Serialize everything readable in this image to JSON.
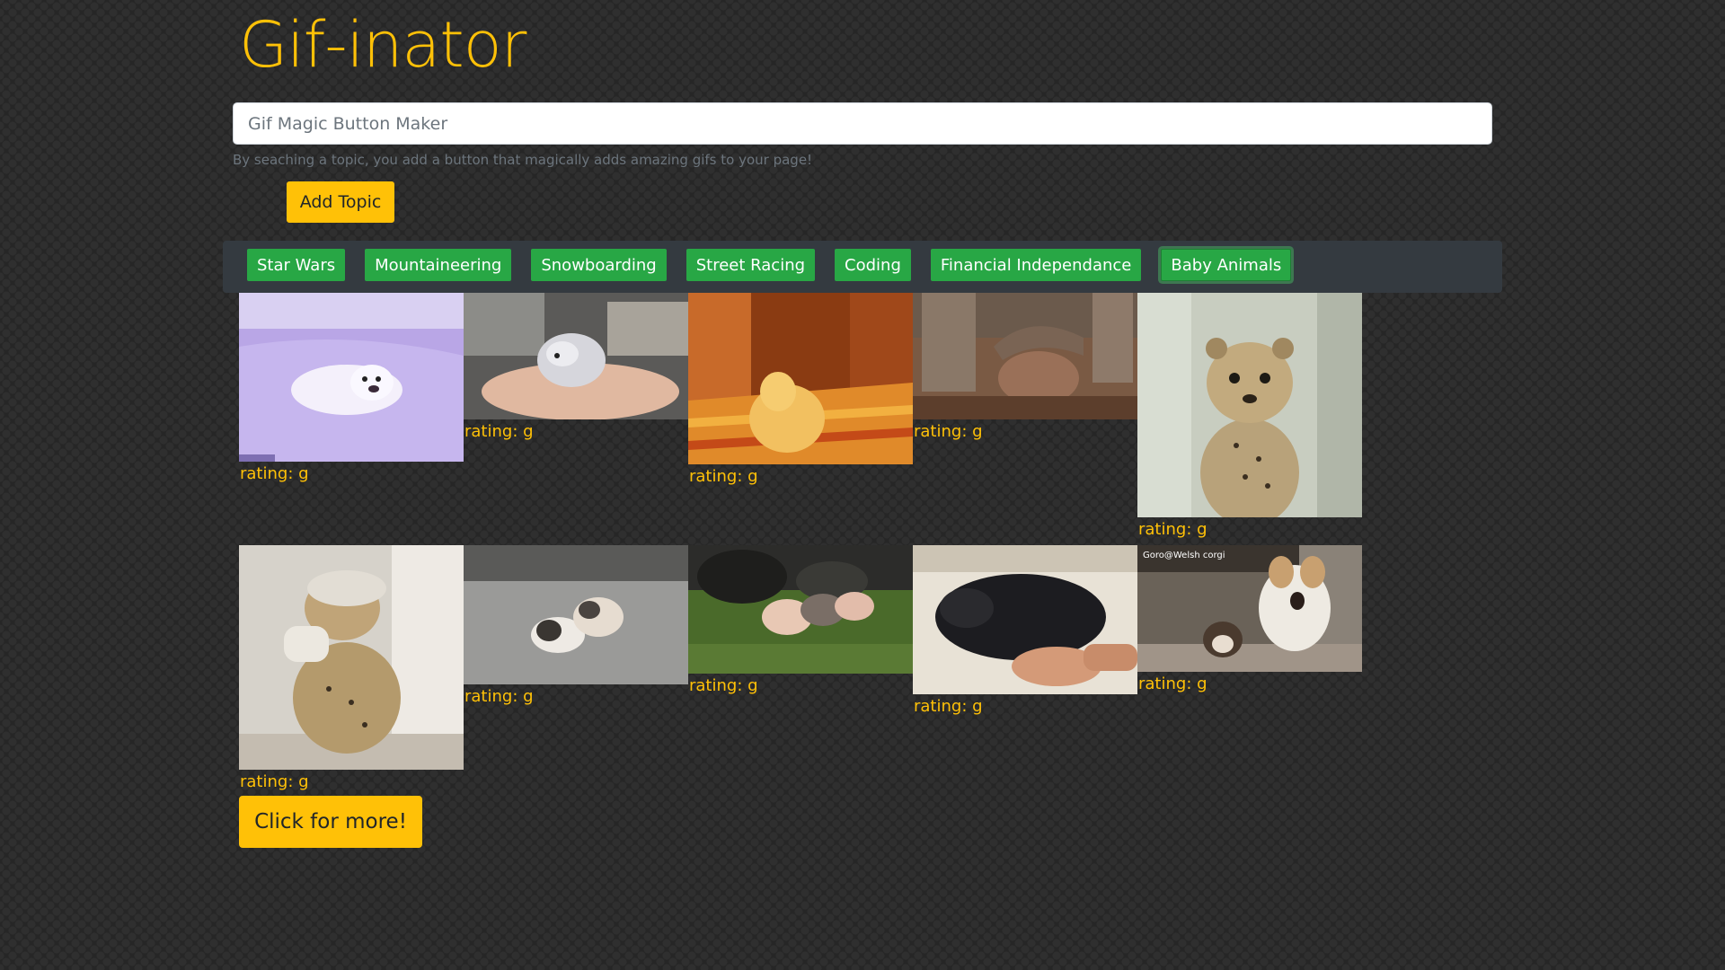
{
  "header": {
    "title": "Gif-inator"
  },
  "search": {
    "placeholder": "Gif Magic Button Maker",
    "help_text": "By seaching a topic, you add a button that magically adds amazing gifs to your page!",
    "add_button_label": "Add Topic"
  },
  "topics": [
    {
      "label": "Star Wars"
    },
    {
      "label": "Mountaineering"
    },
    {
      "label": "Snowboarding"
    },
    {
      "label": "Street Racing"
    },
    {
      "label": "Coding"
    },
    {
      "label": "Financial Independance"
    },
    {
      "label": "Baby Animals"
    }
  ],
  "active_topic": "Baby Animals",
  "gifs": [
    {
      "subject": "baby seal on snow",
      "rating": "rating: g"
    },
    {
      "subject": "baby chinchilla in hands",
      "rating": "rating: g"
    },
    {
      "subject": "bunny on striped cushion",
      "rating": "rating: g"
    },
    {
      "subject": "baby elephant in mud",
      "rating": "rating: g"
    },
    {
      "subject": "cheetah cub",
      "rating": "rating: g"
    },
    {
      "subject": "cheetah cub being petted",
      "rating": "rating: g"
    },
    {
      "subject": "pug puppies",
      "rating": "rating: g"
    },
    {
      "subject": "piglets on grass",
      "rating": "rating: g"
    },
    {
      "subject": "black piglet being rubbed",
      "rating": "rating: g"
    },
    {
      "subject": "corgi and puppy",
      "rating": "rating: g",
      "caption": "Goro@Welsh corgi"
    }
  ],
  "more_button_label": "Click for more!",
  "colors": {
    "accent_yellow": "#ffc107",
    "topic_green": "#28a745",
    "topic_bar_bg": "#343a40",
    "page_bg": "#262626"
  }
}
